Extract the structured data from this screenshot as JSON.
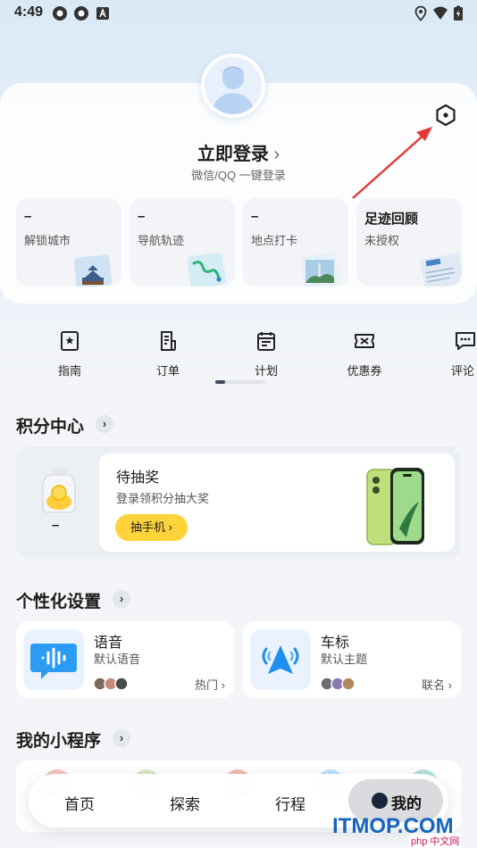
{
  "status_bar": {
    "time": "4:49",
    "left_icons": [
      "circle-badge-icon",
      "circle-badge-icon",
      "a-badge-icon"
    ],
    "right_icons": [
      "location-icon",
      "wifi-icon",
      "battery-icon"
    ]
  },
  "profile": {
    "login_title": "立即登录",
    "login_chevron": "›",
    "login_subtitle": "微信/QQ 一键登录",
    "settings_icon": "settings-hexagon-icon"
  },
  "stats": [
    {
      "value": "–",
      "label": "解锁城市",
      "image": "temple-icon"
    },
    {
      "value": "–",
      "label": "导航轨迹",
      "image": "route-map-icon"
    },
    {
      "value": "–",
      "label": "地点打卡",
      "image": "landmark-photo-icon"
    },
    {
      "value": "足迹回顾",
      "label": "未授权",
      "image": "newspaper-icon"
    }
  ],
  "quick_nav": [
    {
      "label": "指南",
      "icon": "star-book-icon"
    },
    {
      "label": "订单",
      "icon": "receipt-icon"
    },
    {
      "label": "计划",
      "icon": "calendar-icon"
    },
    {
      "label": "优惠券",
      "icon": "ticket-icon"
    },
    {
      "label": "评论",
      "icon": "comment-icon"
    }
  ],
  "points": {
    "section_title": "积分中心",
    "jar_count": "–",
    "title": "待抽奖",
    "subtitle": "登录领积分抽大奖",
    "button": "抽手机 ›"
  },
  "personalize": {
    "section_title": "个性化设置",
    "cards": [
      {
        "title": "语音",
        "subtitle": "默认语音",
        "tag": "热门 ›",
        "icon": "voice-waveform-icon"
      },
      {
        "title": "车标",
        "subtitle": "默认主题",
        "tag": "联名 ›",
        "icon": "car-marker-icon"
      }
    ]
  },
  "mini_programs": {
    "section_title": "我的小程序"
  },
  "bottom_nav": {
    "items": [
      "首页",
      "探索",
      "行程"
    ],
    "active": "我的"
  },
  "watermark": {
    "main": "ITMOP.COM",
    "sub": "php 中文网"
  },
  "colors": {
    "accent_yellow": "#ffd43a",
    "arrow_red": "#e53935",
    "watermark_blue": "#1565c0"
  }
}
